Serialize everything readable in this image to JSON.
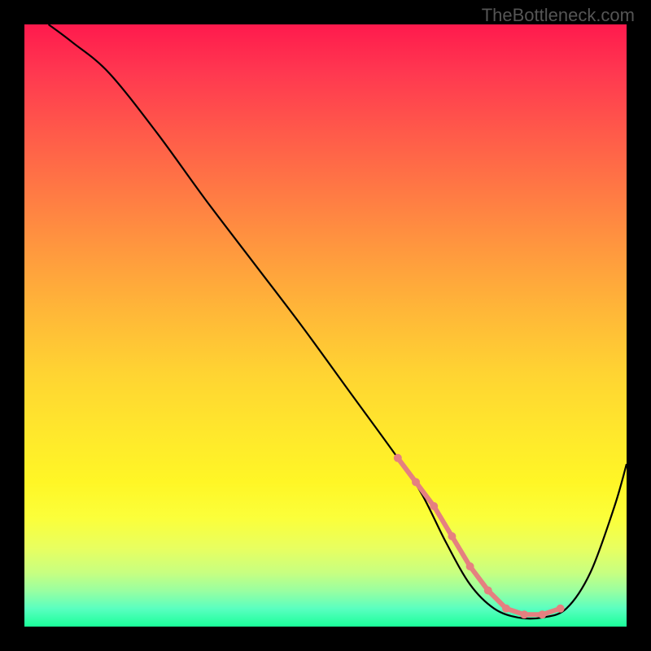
{
  "watermark": "TheBottleneck.com",
  "chart_data": {
    "type": "line",
    "title": "",
    "xlabel": "",
    "ylabel": "",
    "xlim": [
      0,
      100
    ],
    "ylim": [
      0,
      100
    ],
    "series": [
      {
        "name": "bottleneck-curve",
        "x": [
          4,
          8,
          14,
          22,
          30,
          38,
          46,
          54,
          62,
          66,
          70,
          74,
          78,
          82,
          86,
          90,
          94,
          98,
          100
        ],
        "values": [
          100,
          97,
          92,
          82,
          71,
          60.5,
          50,
          39,
          28,
          22,
          14,
          7,
          3,
          1.5,
          1.5,
          3,
          9,
          20,
          27
        ]
      }
    ],
    "flat_region": {
      "color": "#e58080",
      "points_x": [
        62,
        65,
        68,
        71,
        74,
        77,
        80,
        83,
        86,
        89
      ],
      "points_y": [
        28,
        24,
        20,
        15,
        10,
        6,
        3,
        2,
        2,
        3
      ]
    },
    "gradient_stops": [
      {
        "pos": 0,
        "color": "#ff1a4d"
      },
      {
        "pos": 50,
        "color": "#ffd432"
      },
      {
        "pos": 82,
        "color": "#fbff3a"
      },
      {
        "pos": 100,
        "color": "#1aff9a"
      }
    ]
  }
}
